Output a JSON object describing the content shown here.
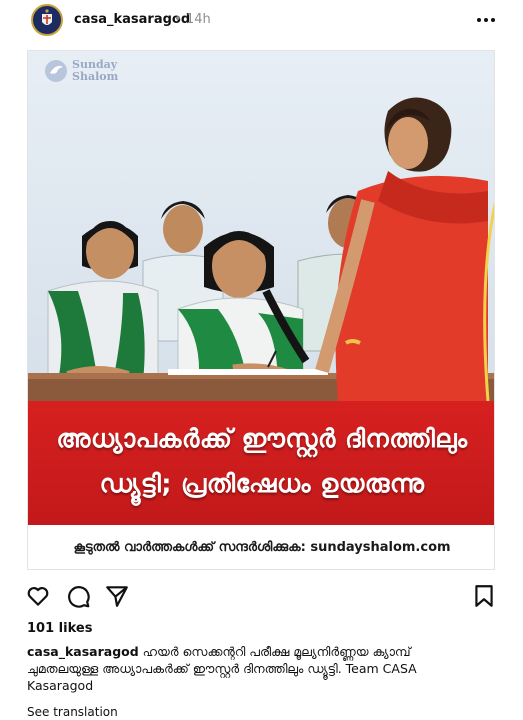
{
  "header": {
    "username": "casa_kasaragod",
    "separator": "•",
    "time": "14h"
  },
  "post": {
    "watermark": {
      "line1": "Sunday",
      "line2": "Shalom"
    },
    "headline_line1": "അധ്യാപകർക്ക് ഈസ്റ്റർ ദിനത്തിലും",
    "headline_line2": "ഡ്യൂട്ടി; പ്രതിഷേധം ഉയരുന്നു",
    "footer": "കൂടുതൽ വാർത്തകൾക്ക് സന്ദർശിക്കുക: sundayshalom.com",
    "banner_color": "#d21f1f"
  },
  "actions": {
    "icons": [
      "heart-icon",
      "comment-icon",
      "share-icon",
      "bookmark-icon"
    ]
  },
  "likes": "101 likes",
  "caption": {
    "user": "casa_kasaragod",
    "text": " ഹയർ  സെക്കന്ററി പരീക്ഷ മൂല്യനിർണ്ണയ ക്യാമ്പ് ചുമതലയുള്ള അധ്യാപകർക്ക് ഈസ്റ്റർ  ദിനത്തിലും ഡ്യൂട്ടി. Team CASA Kasaragod"
  },
  "see_translation": "See translation"
}
